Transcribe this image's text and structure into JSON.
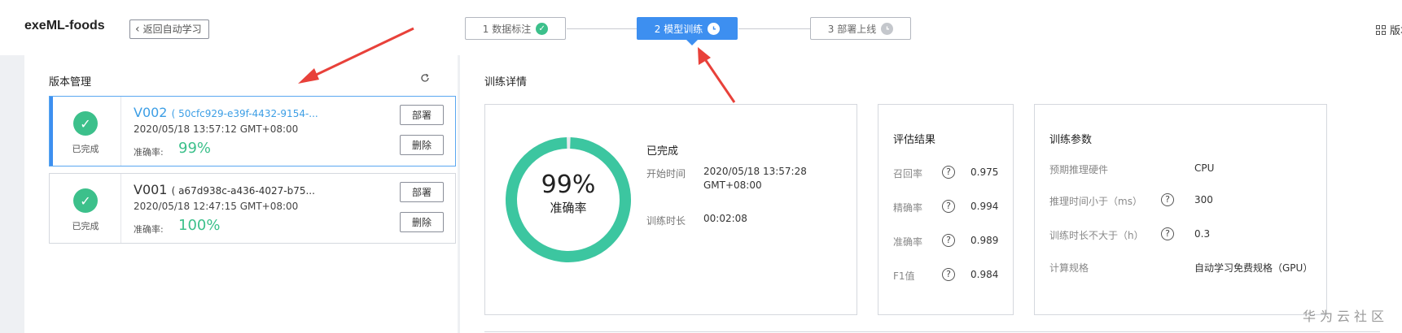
{
  "header": {
    "app_title": "exeML-foods",
    "back_label": "返回自动学习",
    "version_label": "版本"
  },
  "steps": [
    {
      "label": "1 数据标注",
      "state": "done"
    },
    {
      "label": "2 模型训练",
      "state": "active"
    },
    {
      "label": "3 部署上线",
      "state": "pending"
    }
  ],
  "version_panel": {
    "title": "版本管理",
    "versions": [
      {
        "name": "V002",
        "id": "( 50cfc929-e39f-4432-9154-...",
        "date": "2020/05/18 13:57:12 GMT+08:00",
        "status": "已完成",
        "accuracy_label": "准确率:",
        "accuracy": "99%",
        "deploy": "部署",
        "delete": "删除"
      },
      {
        "name": "V001",
        "id": "( a67d938c-a436-4027-b75...",
        "date": "2020/05/18 12:47:15 GMT+08:00",
        "status": "已完成",
        "accuracy_label": "准确率:",
        "accuracy": "100%",
        "deploy": "部署",
        "delete": "删除"
      }
    ]
  },
  "training_detail": {
    "title": "训练详情",
    "summary": {
      "accuracy_value": 0.99,
      "accuracy_text": "99%",
      "accuracy_label": "准确率",
      "status": "已完成",
      "start_label": "开始时间",
      "start_value_line1": "2020/05/18 13:57:28",
      "start_value_line2": "GMT+08:00",
      "duration_label": "训练时长",
      "duration_value": "00:02:08"
    },
    "evaluation": {
      "title": "评估结果",
      "rows": [
        {
          "label": "召回率",
          "value": "0.975"
        },
        {
          "label": "精确率",
          "value": "0.994"
        },
        {
          "label": "准确率",
          "value": "0.989"
        },
        {
          "label": "F1值",
          "value": "0.984"
        }
      ]
    },
    "params": {
      "title": "训练参数",
      "rows": [
        {
          "label": "预期推理硬件",
          "value": "CPU",
          "help": false
        },
        {
          "label": "推理时间小于（ms）",
          "value": "300",
          "help": true
        },
        {
          "label": "训练时长不大于（h）",
          "value": "0.3",
          "help": true
        },
        {
          "label": "计算规格",
          "value": "自动学习免费规格（GPU）",
          "help": false
        }
      ]
    }
  },
  "watermark": "华为云社区",
  "colors": {
    "accent": "#3d8ff0",
    "success": "#3cc08b",
    "annotation": "#e8413a"
  }
}
